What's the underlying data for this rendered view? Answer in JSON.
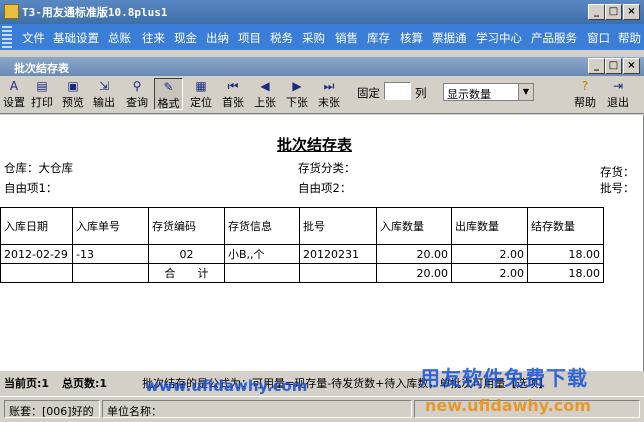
{
  "window": {
    "title": "T3-用友通标准版10.8plus1"
  },
  "menu": [
    "文件",
    "基础设置",
    "总账",
    "往来",
    "现金",
    "出纳",
    "项目",
    "税务",
    "采购",
    "销售",
    "库存",
    "核算",
    "票据通",
    "学习中心",
    "产品服务",
    "窗口",
    "帮助"
  ],
  "subwindow": {
    "title": "批次结存表"
  },
  "toolbar": {
    "buttons": [
      {
        "label": "设置",
        "icon": "A"
      },
      {
        "label": "打印",
        "icon": "▤"
      },
      {
        "label": "预览",
        "icon": "▣"
      },
      {
        "label": "输出",
        "icon": "⇲"
      },
      {
        "label": "查询",
        "icon": "⚲"
      },
      {
        "label": "格式",
        "icon": "✎"
      },
      {
        "label": "定位",
        "icon": "▦"
      },
      {
        "label": "首张",
        "icon": "⏮"
      },
      {
        "label": "上张",
        "icon": "◀"
      },
      {
        "label": "下张",
        "icon": "▶"
      },
      {
        "label": "末张",
        "icon": "⏭"
      }
    ],
    "fixed_label": "固定",
    "fixed_value": "",
    "column_label": "列",
    "display_select": "显示数量",
    "help_label": "帮助",
    "exit_label": "退出"
  },
  "report": {
    "title": "批次结存表",
    "warehouse": "仓库：大仓库",
    "category": "存货分类：",
    "inventory": "存货：",
    "custom1": "自由项1：",
    "custom2": "自由项2：",
    "batch_no": "批号："
  },
  "table": {
    "headers": [
      "入库日期",
      "入库单号",
      "存货编码",
      "存货信息",
      "批号",
      "入库数量",
      "出库数量",
      "结存数量"
    ],
    "rows": [
      [
        "2012-02-29",
        "-13",
        "02",
        "小B,,个",
        "20120231",
        "20.00",
        "2.00",
        "18.00"
      ],
      [
        "",
        "",
        "合　　计",
        "",
        "",
        "20.00",
        "2.00",
        "18.00"
      ]
    ]
  },
  "status": {
    "current_page": "当前页:1",
    "total_pages": "总页数:1",
    "hint": "批次结存的是公式为：可用量=现存量-待发货数+待入库数，单批次可用量【选项】",
    "account": "账套：[006]好的",
    "unit": "单位名称："
  },
  "watermark": {
    "top": "www.ufidawhy.com",
    "big": "用友软件免费下载",
    "url": "new.ufidawhy.com"
  },
  "colors": {
    "menubar": "#3b7ed8",
    "titlebar": "#4a7ab8",
    "watermark": "#1450d8"
  }
}
